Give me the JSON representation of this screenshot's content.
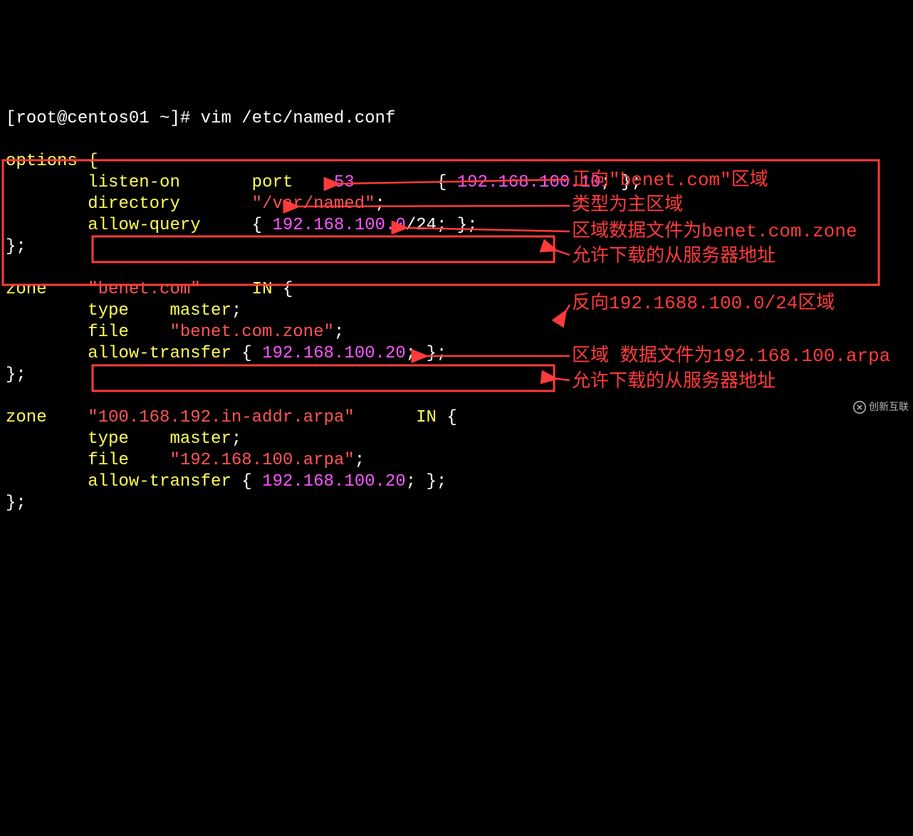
{
  "prompt": {
    "user_host": "[root@centos01 ~]#",
    "command": "vim /etc/named.conf"
  },
  "config": {
    "options_open": "options {",
    "listen_on_kw": "listen-on",
    "port_kw": "port",
    "port_num": "53",
    "listen_ip": "192.168.100.10",
    "directory_kw": "directory",
    "directory_val": "\"/var/named\"",
    "allow_query_kw": "allow-query",
    "allow_query_val": "192.168.100.0",
    "allow_query_mask": "/24",
    "close_brace": "};",
    "zone1_kw": "zone",
    "zone1_name": "\"benet.com\"",
    "in_kw": "IN",
    "type_kw": "type",
    "master_kw": "master",
    "file_kw": "file",
    "zone1_file": "\"benet.com.zone\"",
    "allow_transfer_kw": "allow-transfer",
    "transfer_ip": "192.168.100.20",
    "zone2_name": "\"100.168.192.in-addr.arpa\"",
    "zone2_file": "\"192.168.100.arpa\""
  },
  "annotations": {
    "a1": "正向\"benet.com\"区域",
    "a2": "类型为主区域",
    "a3": "区域数据文件为benet.com.zone",
    "a4": "允许下载的从服务器地址",
    "a5": "反向192.1688.100.0/24区域",
    "a6": "区域 数据文件为192.168.100.arpa",
    "a7": "允许下载的从服务器地址"
  },
  "watermark": "创新互联"
}
